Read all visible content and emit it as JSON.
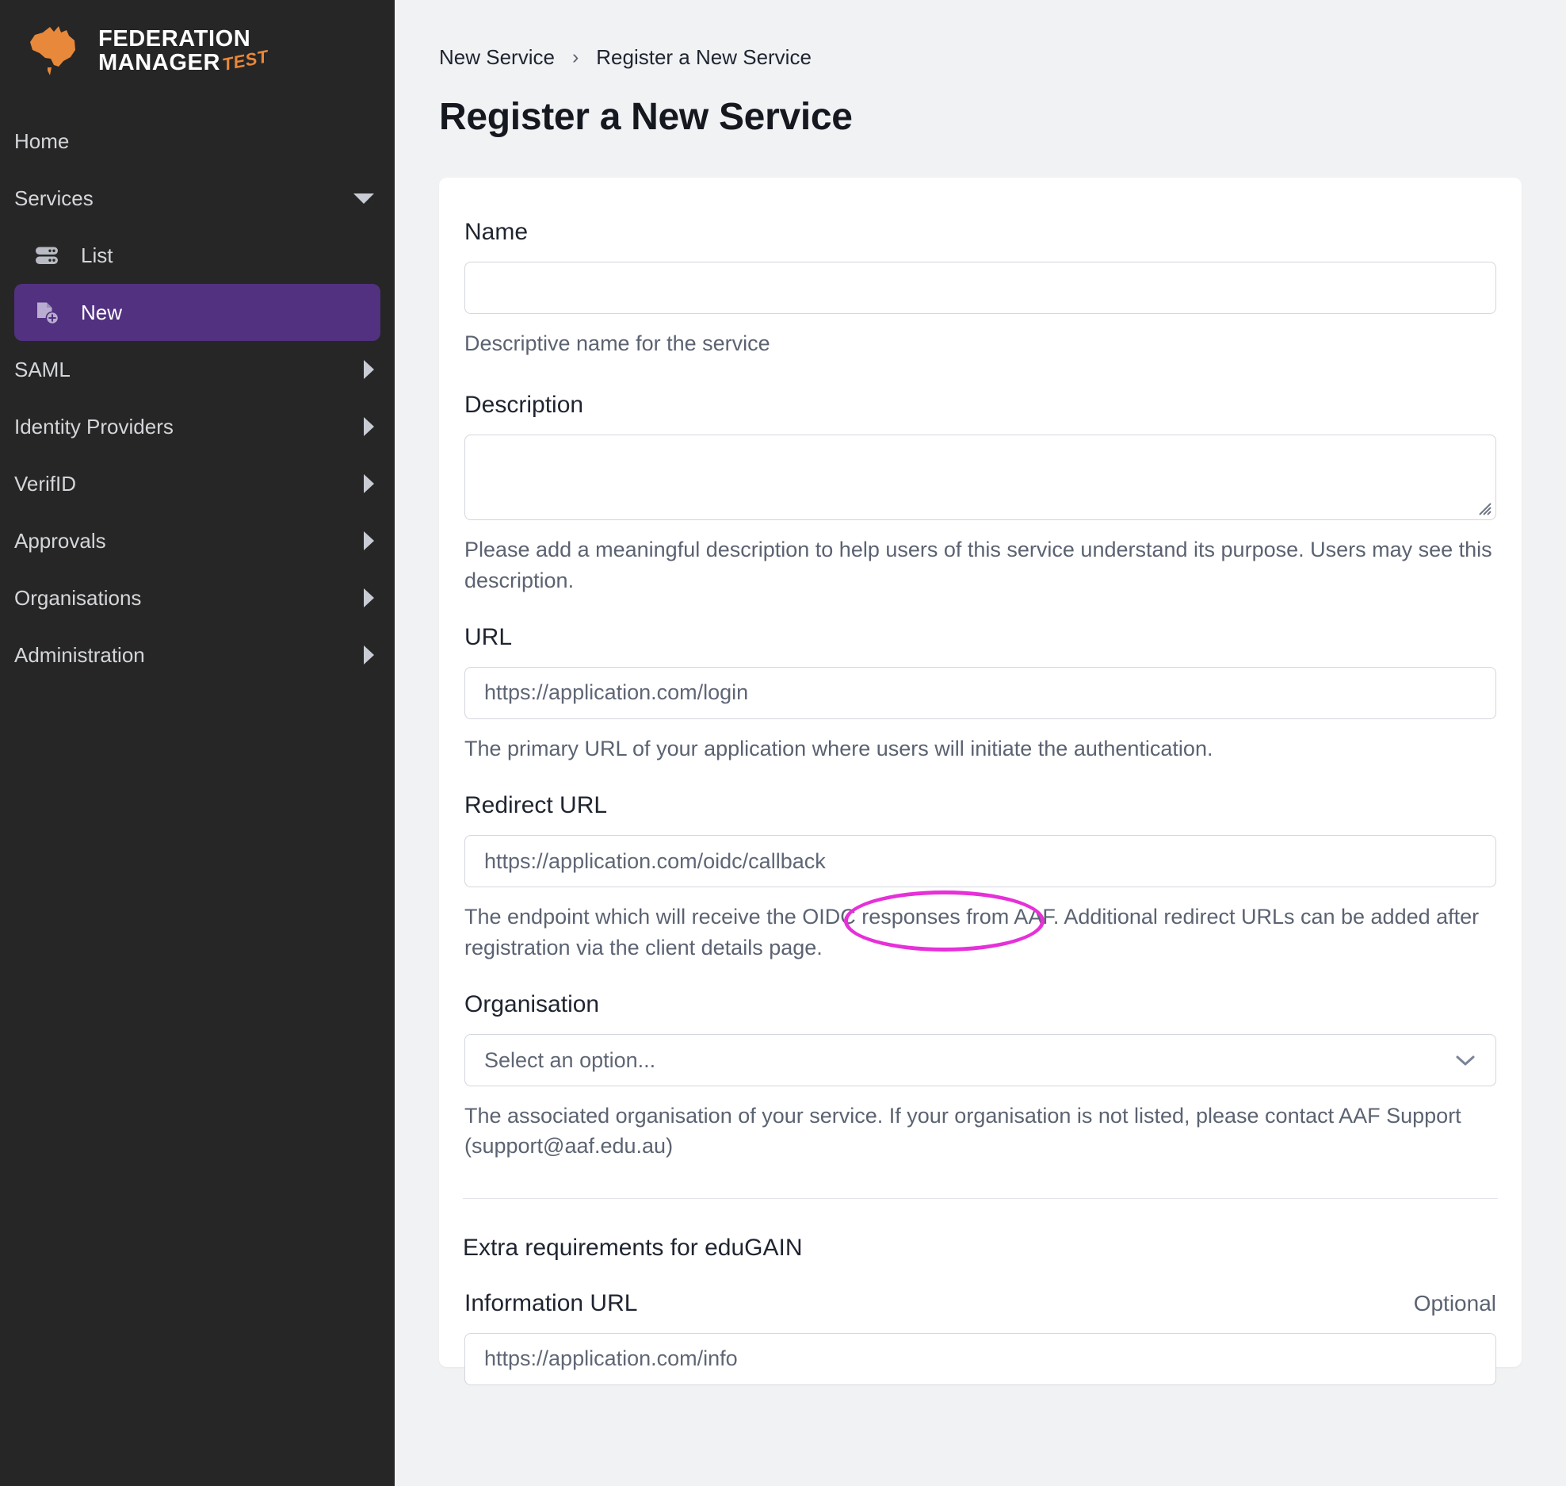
{
  "brand": {
    "line1": "FEDERATION",
    "line2": "MANAGER",
    "badge": "TEST",
    "logo_color": "#e8883a"
  },
  "sidebar": {
    "accent_color": "#523180",
    "background": "#262626",
    "items": [
      {
        "label": "Home",
        "icon": "",
        "chevron": "none",
        "active": false
      },
      {
        "label": "Services",
        "icon": "",
        "chevron": "down",
        "active": false
      }
    ],
    "services_children": [
      {
        "label": "List",
        "icon": "server-icon",
        "active": false
      },
      {
        "label": "New",
        "icon": "file-plus-icon",
        "active": true
      }
    ],
    "items_after": [
      {
        "label": "SAML",
        "chevron": "right"
      },
      {
        "label": "Identity Providers",
        "chevron": "right"
      },
      {
        "label": "VerifID",
        "chevron": "right"
      },
      {
        "label": "Approvals",
        "chevron": "right"
      },
      {
        "label": "Organisations",
        "chevron": "right"
      },
      {
        "label": "Administration",
        "chevron": "right"
      }
    ]
  },
  "breadcrumb": {
    "parent": "New Service",
    "separator": "›",
    "current": "Register a New Service"
  },
  "page": {
    "title": "Register a New Service"
  },
  "form": {
    "name": {
      "label": "Name",
      "value": "",
      "placeholder": "",
      "help": "Descriptive name for the service"
    },
    "description": {
      "label": "Description",
      "value": "",
      "placeholder": "",
      "help": "Please add a meaningful description to help users of this service understand its purpose. Users may see this description."
    },
    "url": {
      "label": "URL",
      "value": "",
      "placeholder": "https://application.com/login",
      "help": "The primary URL of your application where users will initiate the authentication."
    },
    "redirect_url": {
      "label": "Redirect URL",
      "value": "",
      "placeholder": "https://application.com/oidc/callback",
      "help": "The endpoint which will receive the OIDC responses from AAF. Additional redirect URLs can be added after registration via the client details page.",
      "annotated": true,
      "annotation_color": "#e630d8"
    },
    "organisation": {
      "label": "Organisation",
      "selected": "Select an option...",
      "options": [
        "Select an option..."
      ],
      "help": "The associated organisation of your service. If your organisation is not listed, please contact AAF Support (support@aaf.edu.au)"
    },
    "edugain_heading": "Extra requirements for eduGAIN",
    "information_url": {
      "label": "Information URL",
      "optional_tag": "Optional",
      "value": "",
      "placeholder": "https://application.com/info"
    }
  }
}
